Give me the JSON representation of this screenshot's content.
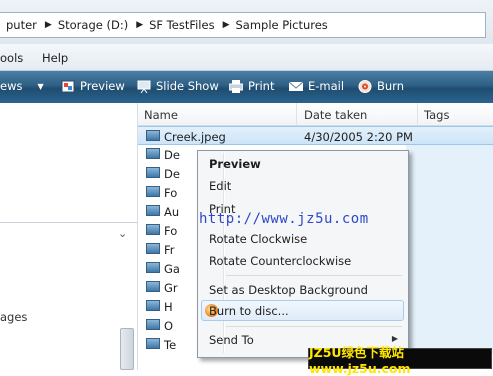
{
  "address": {
    "crumbs": [
      "puter",
      "Storage (D:)",
      "SF TestFiles",
      "Sample Pictures"
    ]
  },
  "menu": {
    "items": [
      "ools",
      "Help"
    ]
  },
  "toolbar": {
    "views_label": "ews",
    "preview": "Preview",
    "slideshow": "Slide Show",
    "print": "Print",
    "email": "E-mail",
    "burn": "Burn"
  },
  "left_pane": {
    "text": "ages"
  },
  "columns": {
    "name": "Name",
    "date": "Date taken",
    "tags": "Tags"
  },
  "files": [
    {
      "name": "Creek.jpeg",
      "date": "4/30/2005 2:20 PM"
    },
    {
      "name": "De",
      "date": ""
    },
    {
      "name": "De",
      "date": ""
    },
    {
      "name": "Fo",
      "date": ""
    },
    {
      "name": "Au",
      "date": ""
    },
    {
      "name": "Fo",
      "date": ""
    },
    {
      "name": "Fr",
      "date": ""
    },
    {
      "name": "Ga",
      "date": ""
    },
    {
      "name": "Gr",
      "date": ""
    },
    {
      "name": "H",
      "date": ""
    },
    {
      "name": "O",
      "date": ""
    },
    {
      "name": "Te",
      "date": ""
    }
  ],
  "context_menu": {
    "preview": "Preview",
    "edit": "Edit",
    "print": "Print",
    "rotate_cw": "Rotate Clockwise",
    "rotate_ccw": "Rotate Counterclockwise",
    "set_bg": "Set as Desktop Background",
    "burn": "Burn to disc...",
    "send_to": "Send To"
  },
  "watermark": {
    "url": "http://www.jz5u.com",
    "badge": "JZ5U绿色下载站www.jz5u.com"
  },
  "colors": {
    "toolbar": "#2e5f85",
    "selection": "#cde5f8",
    "watermark": "#2f48c7",
    "badge_text": "#ffe600"
  }
}
